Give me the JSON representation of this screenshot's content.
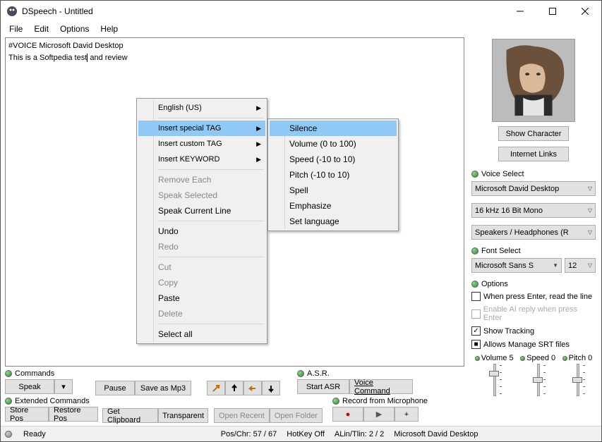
{
  "window": {
    "title": "DSpeech - Untitled"
  },
  "menubar": {
    "items": [
      "File",
      "Edit",
      "Options",
      "Help"
    ]
  },
  "editor": {
    "line1": "#VOICE Microsoft David Desktop",
    "line2a": "This is a Softpedia test",
    "line2b": " and review"
  },
  "context_menu": {
    "english": "English (US)",
    "insert_special": "Insert special TAG",
    "insert_custom": "Insert custom TAG",
    "insert_keyword": "Insert KEYWORD",
    "remove_each": "Remove Each",
    "speak_selected": "Speak Selected",
    "speak_current": "Speak Current Line",
    "undo": "Undo",
    "redo": "Redo",
    "cut": "Cut",
    "copy": "Copy",
    "paste": "Paste",
    "delete": "Delete",
    "select_all": "Select all"
  },
  "submenu": {
    "silence": "Silence",
    "volume": "Volume (0 to 100)",
    "speed": "Speed (-10 to 10)",
    "pitch": "Pitch (-10 to 10)",
    "spell": "Spell",
    "emphasize": "Emphasize",
    "set_language": "Set language"
  },
  "right": {
    "show_character": "Show Character",
    "internet_links": "Internet Links",
    "voice_select_label": "Voice Select",
    "voice": "Microsoft David Desktop",
    "format": "16 kHz 16 Bit Mono",
    "output": "Speakers / Headphones (R",
    "font_select_label": "Font Select",
    "font": "Microsoft Sans S",
    "font_size": "12",
    "options_label": "Options",
    "opt_enter": "When press Enter, read the line",
    "opt_ai": "Enable AI reply when press Enter",
    "opt_tracking": "Show Tracking",
    "opt_srt": "Allows Manage SRT files",
    "vol_label": "Volume 5",
    "speed_label": "Speed 0",
    "pitch_label": "Pitch 0"
  },
  "bottom": {
    "commands_label": "Commands",
    "speak": "Speak",
    "pause": "Pause",
    "save_mp3": "Save as Mp3",
    "ext_label": "Extended Commands",
    "store_pos": "Store Pos",
    "restore_pos": "Restore Pos",
    "get_clipboard": "Get Clipboard",
    "transparent": "Transparent",
    "open_recent": "Open Recent",
    "open_folder": "Open Folder",
    "asr_label": "A.S.R.",
    "start_asr": "Start ASR",
    "voice_cmd": "Voice Command",
    "record_label": "Record from Microphone"
  },
  "status": {
    "ready": "Ready",
    "pos": "Pos/Chr: 57 / 67",
    "hotkey": "HotKey Off",
    "alin": "ALin/Tlin: 2 / 2",
    "voice": "Microsoft David Desktop"
  }
}
